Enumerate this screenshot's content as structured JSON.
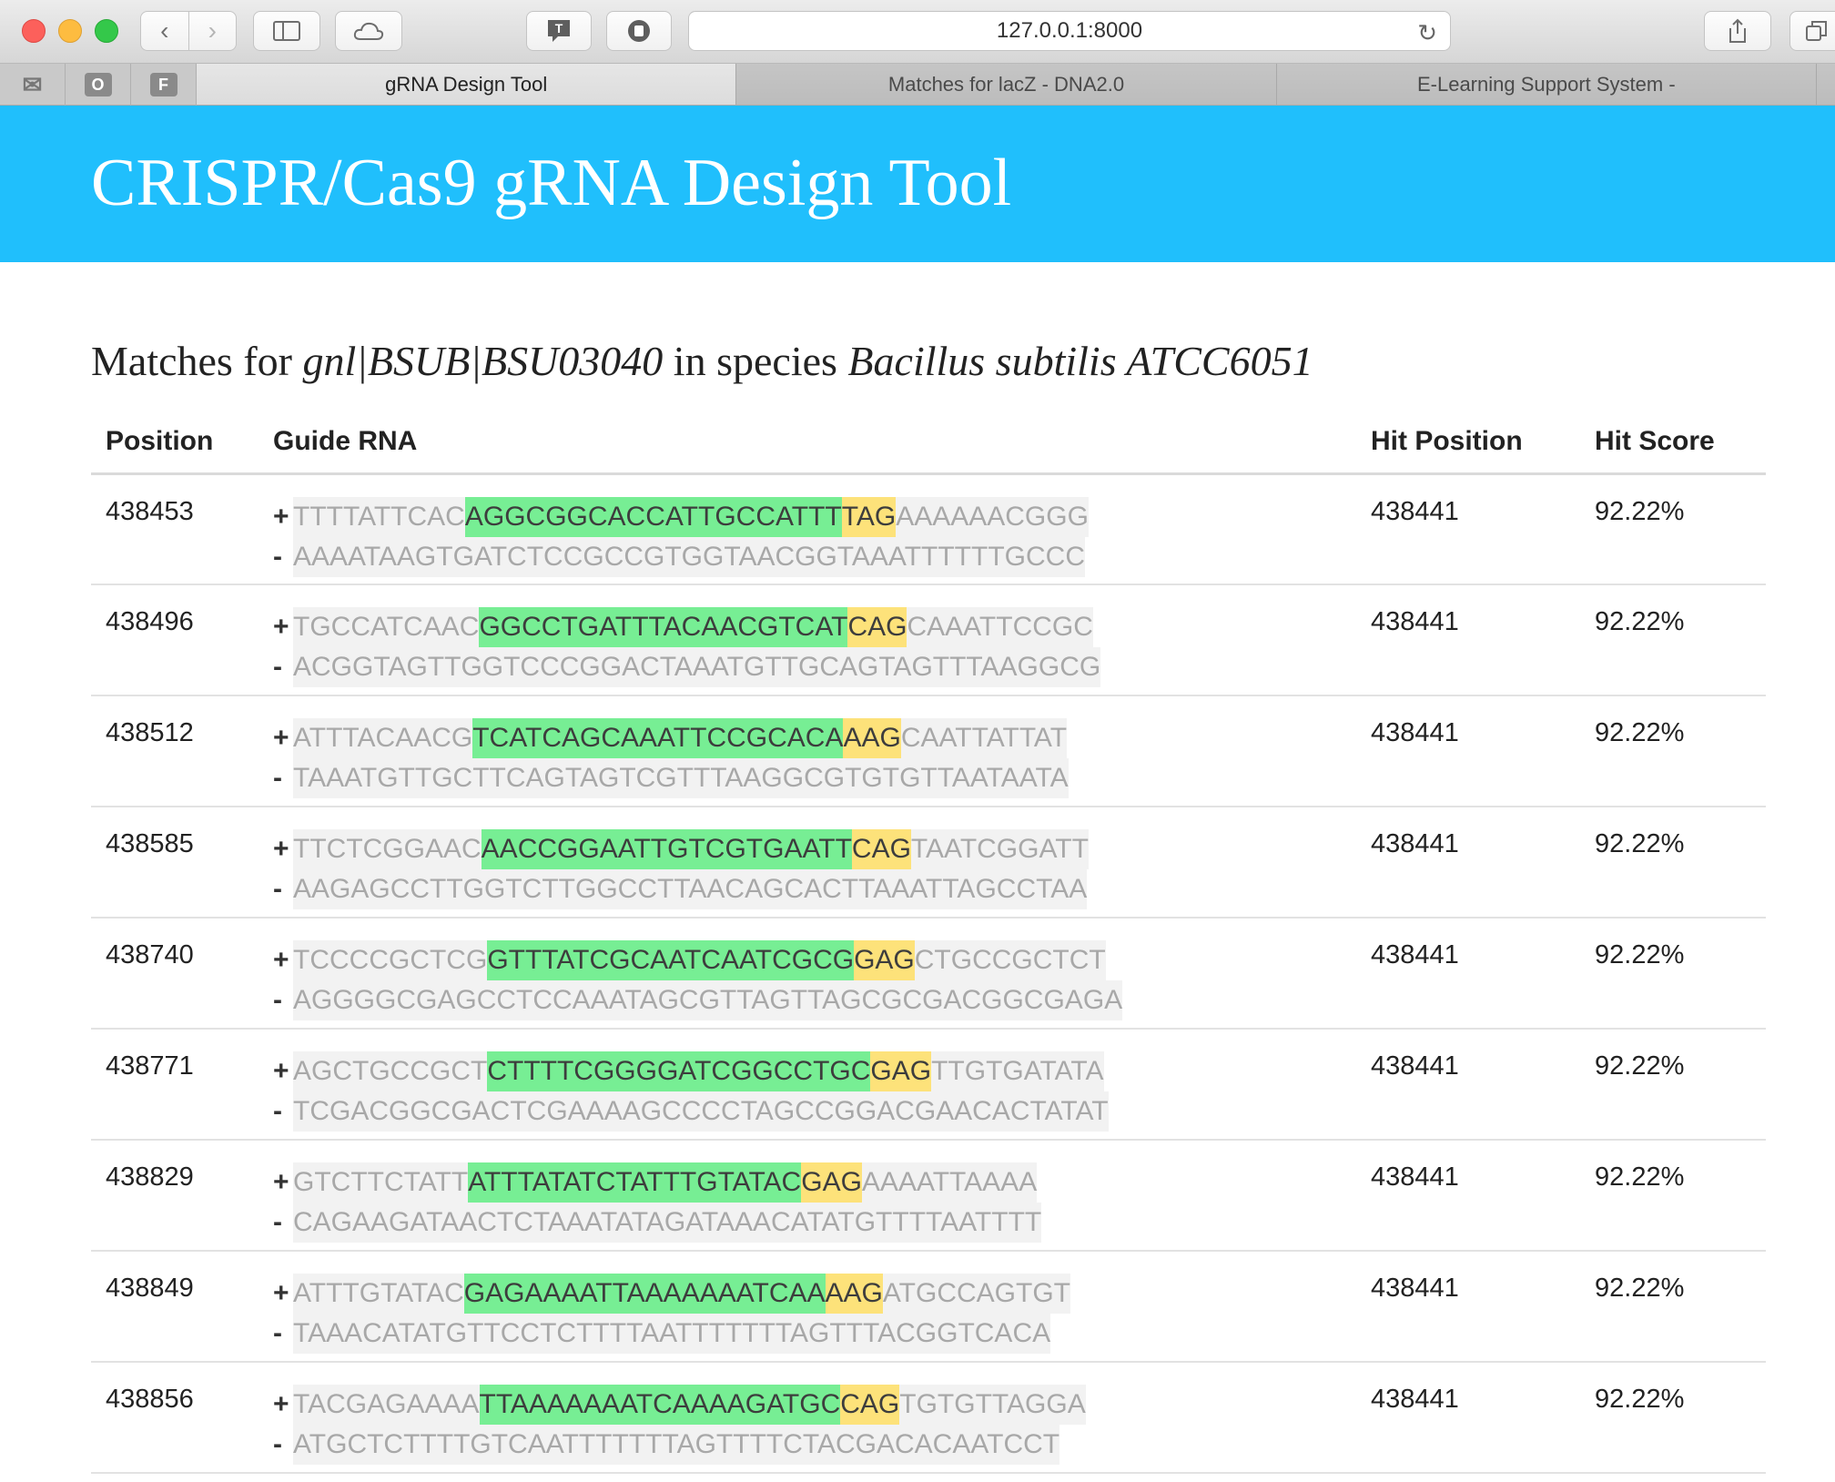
{
  "browser": {
    "url": "127.0.0.1:8000",
    "tabs": [
      "gRNA Design Tool",
      "Matches for lacZ - DNA2.0",
      "E-Learning Support System -"
    ],
    "favorites": [
      "O",
      "F"
    ]
  },
  "header": {
    "title": "CRISPR/Cas9 gRNA Design Tool"
  },
  "subtitle": {
    "prefix": "Matches for ",
    "gene": "gnl|BSUB|BSU03040",
    "middle": " in species ",
    "species": "Bacillus subtilis ATCC6051"
  },
  "table": {
    "headers": [
      "Position",
      "Guide RNA",
      "Hit Position",
      "Hit Score"
    ],
    "plus_symbol": "+",
    "minus_symbol": "-",
    "rows": [
      {
        "position": "438453",
        "plus_pre": "TTTTATTCAC",
        "plus_guide": "AGGCGGCACCATTGCCATTT",
        "plus_pam": "TAG",
        "plus_post": "AAAAAACGGG",
        "minus": "AAAATAAGTGATCTCCGCCGTGGTAACGGTAAATTTTTTGCCC",
        "hit_position": "438441",
        "hit_score": "92.22%"
      },
      {
        "position": "438496",
        "plus_pre": "TGCCATCAAC",
        "plus_guide": "GGCCTGATTTACAACGTCAT",
        "plus_pam": "CAG",
        "plus_post": "CAAATTCCGC",
        "minus": "ACGGTAGTTGGTCCCGGACTAAATGTTGCAGTAGTTTAAGGCG",
        "hit_position": "438441",
        "hit_score": "92.22%"
      },
      {
        "position": "438512",
        "plus_pre": "ATTTACAACG",
        "plus_guide": "TCATCAGCAAATTCCGCACA",
        "plus_pam": "AAG",
        "plus_post": "CAATTATTAT",
        "minus": "TAAATGTTGCTTCAGTAGTCGTTTAAGGCGTGTGTTAATAATA",
        "hit_position": "438441",
        "hit_score": "92.22%"
      },
      {
        "position": "438585",
        "plus_pre": "TTCTCGGAAC",
        "plus_guide": "AACCGGAATTGTCGTGAATT",
        "plus_pam": "CAG",
        "plus_post": "TAATCGGATT",
        "minus": "AAGAGCCTTGGTCTTGGCCTTAACAGCACTTAAATTAGCCTAA",
        "hit_position": "438441",
        "hit_score": "92.22%"
      },
      {
        "position": "438740",
        "plus_pre": "TCCCCGCTCG",
        "plus_guide": "GTTTATCGCAATCAATCGCG",
        "plus_pam": "GAG",
        "plus_post": "CTGCCGCTCT",
        "minus": "AGGGGCGAGCCTCCAAATAGCGTTAGTTAGCGCGACGGCGAGA",
        "hit_position": "438441",
        "hit_score": "92.22%"
      },
      {
        "position": "438771",
        "plus_pre": "AGCTGCCGCT",
        "plus_guide": "CTTTTCGGGGATCGGCCTGC",
        "plus_pam": "GAG",
        "plus_post": "TTGTGATATA",
        "minus": "TCGACGGCGACTCGAAAAGCCCCTAGCCGGACGAACACTATAT",
        "hit_position": "438441",
        "hit_score": "92.22%"
      },
      {
        "position": "438829",
        "plus_pre": "GTCTTCTATT",
        "plus_guide": "ATTTATATCTATTTGTATAC",
        "plus_pam": "GAG",
        "plus_post": "AAAATTAAAA",
        "minus": "CAGAAGATAACTCTAAATATAGATAAACATATGTTTTAATTTT",
        "hit_position": "438441",
        "hit_score": "92.22%"
      },
      {
        "position": "438849",
        "plus_pre": "ATTTGTATAC",
        "plus_guide": "GAGAAAATTAAAAAAATCAA",
        "plus_pam": "AAG",
        "plus_post": "ATGCCAGTGT",
        "minus": "TAAACATATGTTCCTCTTTTAATTTTTTTAGTTTACGGTCACA",
        "hit_position": "438441",
        "hit_score": "92.22%"
      },
      {
        "position": "438856",
        "plus_pre": "TACGAGAAAA",
        "plus_guide": "TTAAAAAAATCAAAAGATGC",
        "plus_pam": "CAG",
        "plus_post": "TGTGTTAGGA",
        "minus": "ATGCTCTTTTGTCAATTTTTTTAGTTTTCTACGACACAATCCT",
        "hit_position": "438441",
        "hit_score": "92.22%"
      }
    ]
  }
}
